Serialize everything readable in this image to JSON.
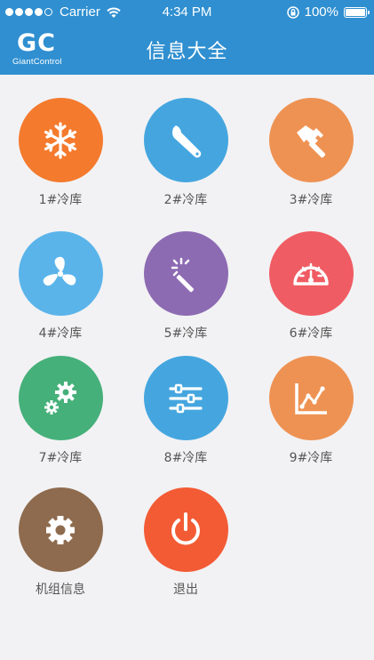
{
  "status": {
    "carrier": "Carrier",
    "time": "4:34 PM",
    "battery": "100%"
  },
  "header": {
    "logo": "GC",
    "logo_sub": "GiantControl",
    "title": "信息大全"
  },
  "tiles": [
    {
      "label": "1#冷库",
      "color": "#f47a2d",
      "icon": "snowflake-icon"
    },
    {
      "label": "2#冷库",
      "color": "#45a6df",
      "icon": "wrench-icon"
    },
    {
      "label": "3#冷库",
      "color": "#ee9253",
      "icon": "hammer-icon"
    },
    {
      "label": "4#冷库",
      "color": "#5ab4ea",
      "icon": "fan-icon"
    },
    {
      "label": "5#冷库",
      "color": "#8d6bb3",
      "icon": "magic-wand-icon"
    },
    {
      "label": "6#冷库",
      "color": "#f05c63",
      "icon": "gauge-icon"
    },
    {
      "label": "7#冷库",
      "color": "#46b07a",
      "icon": "gears-icon"
    },
    {
      "label": "8#冷库",
      "color": "#45a6df",
      "icon": "sliders-icon"
    },
    {
      "label": "9#冷库",
      "color": "#ee9253",
      "icon": "line-chart-icon"
    },
    {
      "label": "机组信息",
      "color": "#8e6b4e",
      "icon": "gear-icon"
    },
    {
      "label": "退出",
      "color": "#f35b35",
      "icon": "power-icon"
    }
  ]
}
